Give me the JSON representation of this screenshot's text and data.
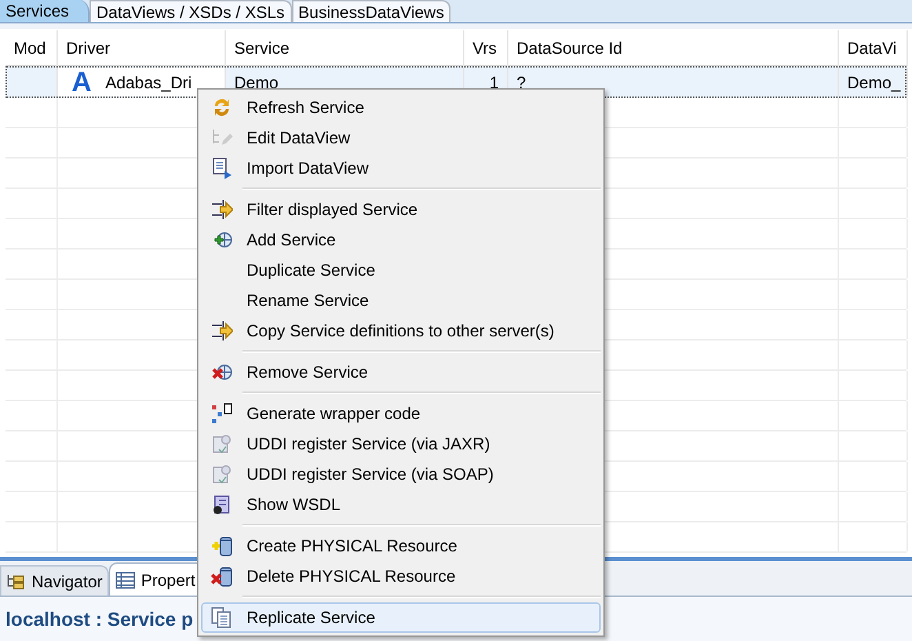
{
  "tabs": [
    {
      "label": "Services",
      "selected": true
    },
    {
      "label": "DataViews / XSDs / XSLs",
      "selected": false
    },
    {
      "label": "BusinessDataViews",
      "selected": false
    }
  ],
  "table": {
    "columns": [
      "Mod",
      "Driver",
      "Service",
      "Vrs",
      "DataSource Id",
      "DataVi"
    ],
    "rows": [
      {
        "selected": true,
        "mod": "",
        "driver_badge": "A",
        "driver": "Adabas_Dri",
        "service": "Demo",
        "vrs": "1",
        "datasource_id": "?",
        "column_6": "Demo_"
      }
    ]
  },
  "context_menu": {
    "groups": [
      [
        {
          "label": "Refresh Service",
          "kind": "refresh",
          "selected": false
        },
        {
          "label": "Edit DataView",
          "kind": "edit",
          "selected": false
        },
        {
          "label": "Import DataView",
          "kind": "import",
          "selected": false
        }
      ],
      [
        {
          "label": "Filter displayed Service",
          "kind": "arrows",
          "selected": false
        },
        {
          "label": "Add Service",
          "kind": "add",
          "selected": false
        },
        {
          "label": "Duplicate Service",
          "kind": "plain",
          "selected": false
        },
        {
          "label": "Rename Service",
          "kind": "plain",
          "selected": false
        },
        {
          "label": "Copy Service definitions to other server(s)",
          "kind": "arrows",
          "selected": false
        }
      ],
      [
        {
          "label": "Remove Service",
          "kind": "remove",
          "selected": false
        }
      ],
      [
        {
          "label": "Generate wrapper code",
          "kind": "generate",
          "selected": false
        },
        {
          "label": "UDDI register Service (via JAXR)",
          "kind": "uddi",
          "selected": false
        },
        {
          "label": "UDDI register Service (via SOAP)",
          "kind": "uddi",
          "selected": false
        },
        {
          "label": "Show WSDL",
          "kind": "wsdl",
          "selected": false
        }
      ],
      [
        {
          "label": "Create PHYSICAL Resource",
          "kind": "create",
          "selected": false
        },
        {
          "label": "Delete PHYSICAL Resource",
          "kind": "delete",
          "selected": false
        }
      ],
      [
        {
          "label": "Replicate Service",
          "kind": "replicate",
          "selected": true
        }
      ]
    ]
  },
  "bottom_tabs": [
    {
      "label": "Navigator",
      "selected": false
    },
    {
      "label": "Propert",
      "selected": true
    }
  ],
  "panel_title": "localhost : Service p"
}
